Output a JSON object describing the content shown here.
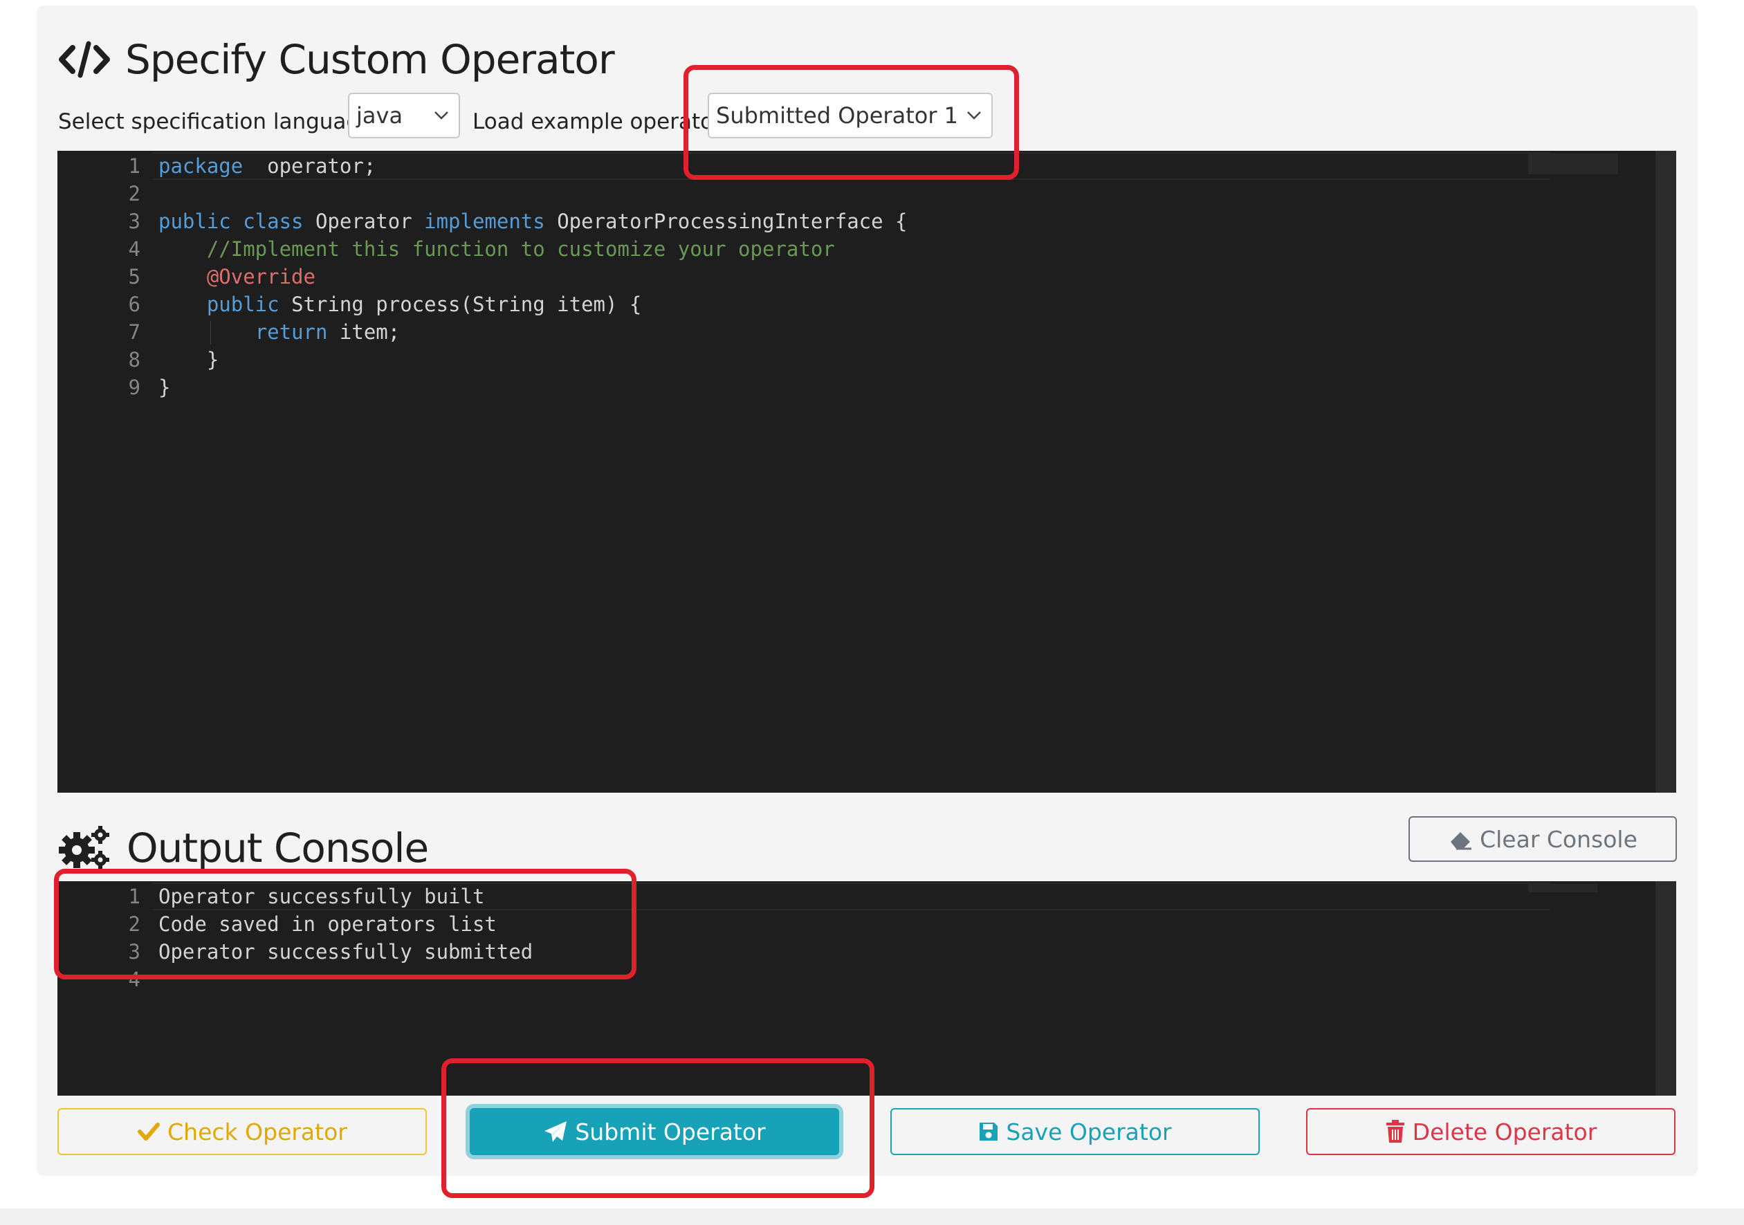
{
  "editor_section": {
    "title": "Specify Custom Operator",
    "language_label": "Select specification language",
    "language_value": "java",
    "example_label": "Load example operator",
    "example_value": "Submitted Operator 1",
    "code_lines": [
      {
        "n": "1",
        "segments": [
          [
            "kw",
            "package"
          ],
          [
            "",
            "  operator;"
          ]
        ]
      },
      {
        "n": "2",
        "segments": []
      },
      {
        "n": "3",
        "segments": [
          [
            "kw",
            "public class"
          ],
          [
            "",
            " Operator "
          ],
          [
            "kw",
            "implements"
          ],
          [
            "",
            " OperatorProcessingInterface {"
          ]
        ]
      },
      {
        "n": "4",
        "segments": [
          [
            "",
            "    "
          ],
          [
            "cm",
            "//Implement this function to customize your operator"
          ]
        ]
      },
      {
        "n": "5",
        "segments": [
          [
            "",
            "    "
          ],
          [
            "an",
            "@Override"
          ]
        ]
      },
      {
        "n": "6",
        "segments": [
          [
            "",
            "    "
          ],
          [
            "kw",
            "public"
          ],
          [
            "",
            " String process(String item) {"
          ]
        ]
      },
      {
        "n": "7",
        "segments": [
          [
            "",
            "        "
          ],
          [
            "kw",
            "return"
          ],
          [
            "",
            " item;"
          ]
        ]
      },
      {
        "n": "8",
        "segments": [
          [
            "",
            "    }"
          ]
        ]
      },
      {
        "n": "9",
        "segments": [
          [
            "",
            "}"
          ]
        ]
      }
    ]
  },
  "console_section": {
    "title": "Output Console",
    "clear_label": "Clear Console",
    "lines": [
      {
        "n": "1",
        "text": "Operator successfully built"
      },
      {
        "n": "2",
        "text": "Code saved in operators list"
      },
      {
        "n": "3",
        "text": "Operator successfully submitted"
      },
      {
        "n": "4",
        "text": ""
      }
    ]
  },
  "actions": {
    "check_label": "Check Operator",
    "submit_label": "Submit Operator",
    "save_label": "Save Operator",
    "delete_label": "Delete Operator"
  },
  "icons": {
    "heading_editor": "code-icon",
    "heading_console": "gears-icon",
    "clear": "eraser-icon",
    "check": "check-icon",
    "submit": "paper-plane-icon",
    "save": "floppy-disk-icon",
    "delete": "trash-icon",
    "select": "chevron-down-icon"
  },
  "colors": {
    "highlight": "#e0202a",
    "editor_bg": "#1e1e1e",
    "check": "#f4c430",
    "submit": "#17a2b8",
    "delete": "#dc3545"
  }
}
